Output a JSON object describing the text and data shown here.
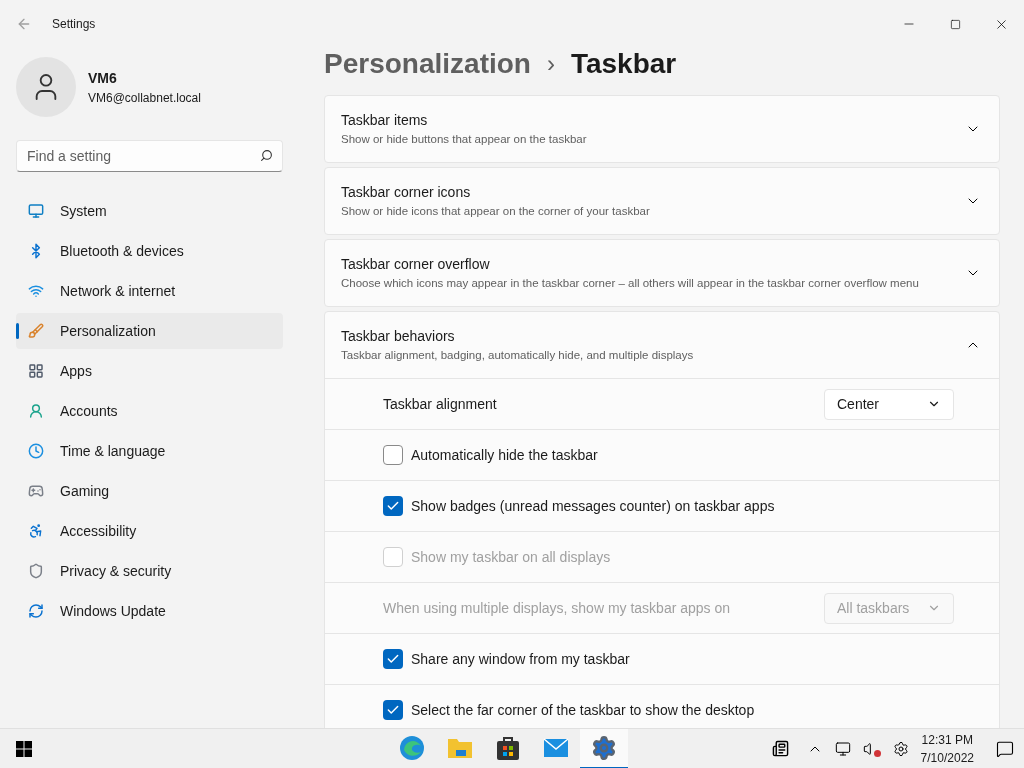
{
  "window": {
    "title": "Settings"
  },
  "user": {
    "name": "VM6",
    "email": "VM6@collabnet.local"
  },
  "search": {
    "placeholder": "Find a setting"
  },
  "nav": [
    {
      "label": "System",
      "selected": false
    },
    {
      "label": "Bluetooth & devices",
      "selected": false
    },
    {
      "label": "Network & internet",
      "selected": false
    },
    {
      "label": "Personalization",
      "selected": true
    },
    {
      "label": "Apps",
      "selected": false
    },
    {
      "label": "Accounts",
      "selected": false
    },
    {
      "label": "Time & language",
      "selected": false
    },
    {
      "label": "Gaming",
      "selected": false
    },
    {
      "label": "Accessibility",
      "selected": false
    },
    {
      "label": "Privacy & security",
      "selected": false
    },
    {
      "label": "Windows Update",
      "selected": false
    }
  ],
  "breadcrumb": {
    "parent": "Personalization",
    "separator": "›",
    "current": "Taskbar"
  },
  "sections": [
    {
      "title": "Taskbar items",
      "description": "Show or hide buttons that appear on the taskbar",
      "expanded": false
    },
    {
      "title": "Taskbar corner icons",
      "description": "Show or hide icons that appear on the corner of your taskbar",
      "expanded": false
    },
    {
      "title": "Taskbar corner overflow",
      "description": "Choose which icons may appear in the taskbar corner – all others will appear in the taskbar corner overflow menu",
      "expanded": false
    },
    {
      "title": "Taskbar behaviors",
      "description": "Taskbar alignment, badging, automatically hide, and multiple displays",
      "expanded": true,
      "rows": [
        {
          "kind": "dropdown",
          "label": "Taskbar alignment",
          "value": "Center",
          "disabled": false
        },
        {
          "kind": "checkbox",
          "label": "Automatically hide the taskbar",
          "checked": false,
          "disabled": false
        },
        {
          "kind": "checkbox",
          "label": "Show badges (unread messages counter) on taskbar apps",
          "checked": true,
          "disabled": false
        },
        {
          "kind": "checkbox",
          "label": "Show my taskbar on all displays",
          "checked": false,
          "disabled": true
        },
        {
          "kind": "dropdown",
          "label": "When using multiple displays, show my taskbar apps on",
          "value": "All taskbars",
          "disabled": true
        },
        {
          "kind": "checkbox",
          "label": "Share any window from my taskbar",
          "checked": true,
          "disabled": false
        },
        {
          "kind": "checkbox",
          "label": "Select the far corner of the taskbar to show the desktop",
          "checked": true,
          "disabled": false
        }
      ]
    }
  ],
  "taskbar": {
    "apps": [
      {
        "kind": "edge",
        "selected": false
      },
      {
        "kind": "folder",
        "selected": false
      },
      {
        "kind": "store",
        "selected": false
      },
      {
        "kind": "mail",
        "selected": false
      },
      {
        "kind": "settings",
        "selected": true
      }
    ],
    "time": "12:31 PM",
    "date": "7/10/2022"
  }
}
